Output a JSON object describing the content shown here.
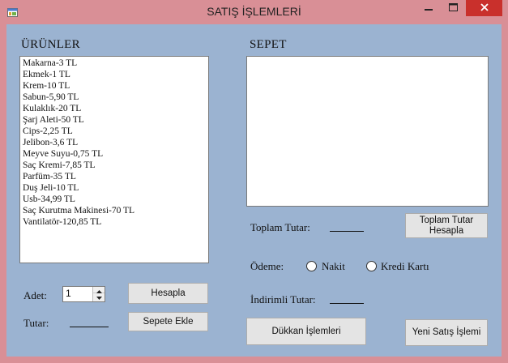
{
  "window": {
    "title": "SATIŞ İŞLEMLERİ"
  },
  "urunler": {
    "header": "ÜRÜNLER",
    "items": [
      "Makarna-3 TL",
      "Ekmek-1 TL",
      "Krem-10 TL",
      "Sabun-5,90 TL",
      "Kulaklık-20 TL",
      "Şarj Aleti-50 TL",
      "Cips-2,25 TL",
      "Jelibon-3,6 TL",
      "Meyve Suyu-0,75 TL",
      "Saç Kremi-7,85 TL",
      "Parfüm-35 TL",
      "Duş Jeli-10 TL",
      "Usb-34,99 TL",
      "Saç Kurutma Makinesi-70 TL",
      "Vantilatör-120,85 TL"
    ]
  },
  "sepet": {
    "header": "SEPET",
    "items": []
  },
  "adet": {
    "label": "Adet:",
    "value": "1"
  },
  "tutar": {
    "label": "Tutar:"
  },
  "buttons": {
    "hesapla": "Hesapla",
    "sepete_ekle": "Sepete Ekle",
    "toplam_tutar_hesapla_line1": "Toplam Tutar",
    "toplam_tutar_hesapla_line2": "Hesapla",
    "dukkan_islemleri": "Dükkan İşlemleri",
    "yeni_satis_islemi": "Yeni Satış İşlemi"
  },
  "toplam": {
    "label": "Toplam Tutar:"
  },
  "odeme": {
    "label": "Ödeme:",
    "nakit": "Nakit",
    "kredi_karti": "Kredi Kartı"
  },
  "indirimli": {
    "label": "İndirimli Tutar:"
  },
  "colors": {
    "titlebar": "#d98f96",
    "client": "#9bb3d1",
    "close": "#c9302c"
  }
}
